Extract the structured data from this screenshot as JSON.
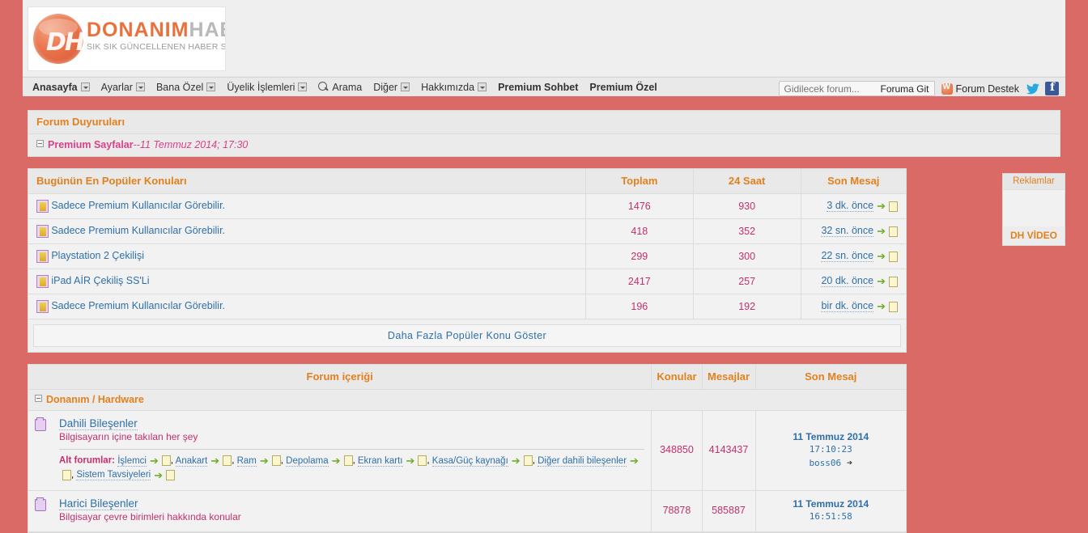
{
  "site": {
    "logo_dh": "DH",
    "logo_word1": "DONANIM",
    "logo_word2": "HABER",
    "logo_tagline": "SIK SIK GÜNCELLENEN HABER SİTESİ"
  },
  "nav": {
    "items": [
      {
        "label": "Anasayfa",
        "caret": true,
        "bold": true
      },
      {
        "label": "Ayarlar",
        "caret": true,
        "bold": false
      },
      {
        "label": "Bana Özel",
        "caret": true,
        "bold": false
      },
      {
        "label": "Üyelik İşlemleri",
        "caret": true,
        "bold": false
      },
      {
        "label": "Arama",
        "caret": false,
        "bold": false,
        "icon": "search-icon"
      },
      {
        "label": "Diğer",
        "caret": true,
        "bold": false
      },
      {
        "label": "Hakkımızda",
        "caret": true,
        "bold": false
      },
      {
        "label": "Premium Sohbet",
        "caret": false,
        "bold": true
      },
      {
        "label": "Premium Özel",
        "caret": false,
        "bold": true
      }
    ],
    "goto_placeholder": "Gidilecek forum...",
    "goto_value": "",
    "goto_button": "Foruma Git",
    "support_label": "Forum Destek"
  },
  "announcements": {
    "title": "Forum Duyuruları",
    "items": [
      {
        "title": "Premium Sayfalar",
        "date": "--11 Temmuz 2014; 17:30"
      }
    ]
  },
  "popular": {
    "title": "Bugünün En Popüler Konuları",
    "columns": [
      "Toplam",
      "24 Saat",
      "Son Mesaj"
    ],
    "rows": [
      {
        "title": "Sadece Premium Kullanıcılar Görebilir.",
        "total": "1476",
        "day": "930",
        "last": "3 dk. önce"
      },
      {
        "title": "Sadece Premium Kullanıcılar Görebilir.",
        "total": "418",
        "day": "352",
        "last": "32 sn. önce"
      },
      {
        "title": "Playstation 2 Çekilişi",
        "total": "299",
        "day": "300",
        "last": "22 sn. önce"
      },
      {
        "title": "iPad AİR Çekiliş SS'Li",
        "total": "2417",
        "day": "257",
        "last": "20 dk. önce"
      },
      {
        "title": "Sadece Premium Kullanıcılar Görebilir.",
        "total": "196",
        "day": "192",
        "last": "bir dk. önce"
      }
    ],
    "more_label": "Daha Fazla Popüler Konu Göster"
  },
  "ads": {
    "title": "Reklamlar",
    "footer": "DH VİDEO"
  },
  "forum": {
    "columns": [
      "Forum içeriği",
      "Konular",
      "Mesajlar",
      "Son Mesaj"
    ],
    "categories": [
      {
        "name": "Donanım / Hardware",
        "forums": [
          {
            "name": "Dahili Bileşenler",
            "desc": "Bilgisayarın içine takılan her şey",
            "sub_label": "Alt forumlar:",
            "subforums": [
              "İşlemci",
              "Anakart",
              "Ram",
              "Depolama",
              "Ekran kartı",
              "Kasa/Güç kaynağı",
              "Diğer dahili bileşenler",
              "Sistem Tavsiyeleri"
            ],
            "topics": "348850",
            "posts": "4143437",
            "last_date": "11 Temmuz 2014",
            "last_time": "17:10:23",
            "last_user": "boss06"
          },
          {
            "name": "Harici Bileşenler",
            "desc": "Bilgisayar çevre birimleri hakkında konular",
            "sub_label": "",
            "subforums": [],
            "topics": "78878",
            "posts": "585887",
            "last_date": "11 Temmuz 2014",
            "last_time": "16:51:58",
            "last_user": ""
          }
        ]
      }
    ]
  },
  "colors": {
    "page_bg": "#d96a66",
    "panel_bg": "#f0f0f0",
    "accent_orange": "#e2801e",
    "link_blue": "#2f6fa8",
    "pink": "#c2306e"
  }
}
